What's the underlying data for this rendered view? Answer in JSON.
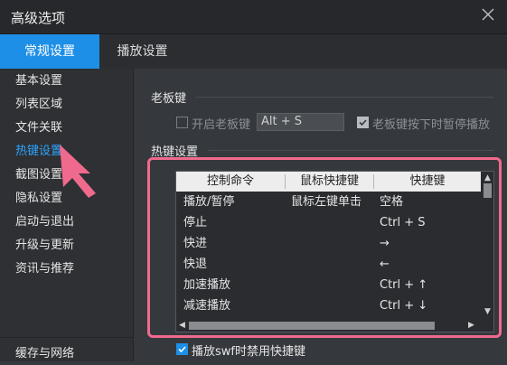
{
  "window": {
    "title": "高级选项"
  },
  "tabs": [
    {
      "label": "常规设置",
      "active": true
    },
    {
      "label": "播放设置",
      "active": false
    }
  ],
  "sidebar": {
    "items": [
      {
        "label": "基本设置"
      },
      {
        "label": "列表区域"
      },
      {
        "label": "文件关联"
      },
      {
        "label": "热键设置",
        "active": true
      },
      {
        "label": "截图设置"
      },
      {
        "label": "隐私设置"
      },
      {
        "label": "启动与退出"
      },
      {
        "label": "升级与更新"
      },
      {
        "label": "资讯与推荐"
      }
    ],
    "bottom_item": "缓存与网络"
  },
  "boss_key": {
    "section_label": "老板键",
    "enable_label": "开启老板键",
    "enable_checked": false,
    "key_value": "Alt + S",
    "pause_label": "老板键按下时暂停播放",
    "pause_checked": true
  },
  "hotkeys": {
    "section_label": "热键设置",
    "columns": [
      "控制命令",
      "鼠标快捷键",
      "快捷键"
    ],
    "rows": [
      {
        "command": "播放/暂停",
        "mouse": "鼠标左键单击",
        "key": "空格"
      },
      {
        "command": "停止",
        "mouse": "",
        "key": "Ctrl + S"
      },
      {
        "command": "快进",
        "mouse": "",
        "key": "→"
      },
      {
        "command": "快退",
        "mouse": "",
        "key": "←"
      },
      {
        "command": "加速播放",
        "mouse": "",
        "key": "Ctrl + ↑"
      },
      {
        "command": "减速播放",
        "mouse": "",
        "key": "Ctrl + ↓"
      }
    ],
    "disable_swf_label": "播放swf时禁用快捷键",
    "disable_swf_checked": true
  },
  "colors": {
    "accent": "#1e8fe6",
    "highlight": "#f06a8e",
    "active_sidebar": "#2ea4ff"
  }
}
